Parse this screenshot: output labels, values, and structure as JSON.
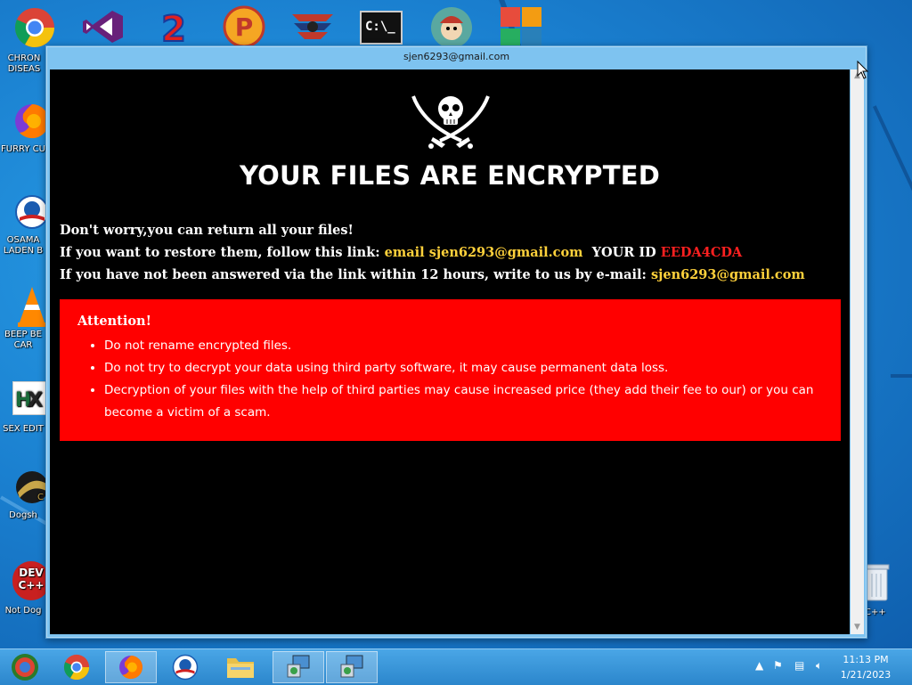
{
  "desktop": {
    "icons": [
      {
        "label": "CHRON DISEAS",
        "icon": "chrome-icon"
      },
      {
        "label": "FURRY CU",
        "icon": "firefox-icon"
      },
      {
        "label": "OSAMA LADEN B",
        "icon": "obama-logo-icon"
      },
      {
        "label": "BEEP BE CAR",
        "icon": "vlc-cone-icon"
      },
      {
        "label": "SEX EDIT",
        "icon": "hxd-editor-icon"
      },
      {
        "label": "Dogsh",
        "icon": "dogecoin-icon"
      },
      {
        "label": "Not Dog",
        "icon": "dev-cpp-icon"
      },
      {
        "label": "n C++",
        "icon": "recycle-bin-icon"
      }
    ],
    "top_icons": [
      "chrome-icon",
      "visual-studio-icon",
      "app-2-icon",
      "pacman-p-icon",
      "eagle-icon",
      "cmd-icon",
      "mascot-icon",
      "avg-icon"
    ],
    "dev_icon_text": "DEV C++",
    "cmd_icon_text": "C:\\_"
  },
  "window": {
    "title": "sjen6293@gmail.com",
    "headline": "YOUR FILES ARE ENCRYPTED",
    "line1": "Don't worry,you can return all your files!",
    "line2_prefix": "If you want to restore them, follow this link:",
    "line2_email": "email sjen6293@gmail.com",
    "line2_id_label": "YOUR ID",
    "line2_id_value": "EEDA4CDA",
    "line3_prefix": "If you have not been answered via the link within 12 hours, write to us by e-mail:",
    "line3_email": "sjen6293@gmail.com",
    "attention": {
      "title": "Attention!",
      "items": [
        "Do not rename encrypted files.",
        "Do not try to decrypt your data using third party software, it may cause permanent data loss.",
        "Decryption of your files with the help of third parties may cause increased price (they add their fee to our) or you can become a victim of a scam."
      ]
    }
  },
  "taskbar": {
    "buttons": [
      "start-button",
      "chrome-icon",
      "firefox-icon",
      "obama-logo-icon",
      "file-explorer-icon",
      "installer-icon",
      "installer-icon"
    ],
    "clock_time": "11:13 PM",
    "clock_date": "1/21/2023"
  },
  "colors": {
    "window_bg": "#000000",
    "attention_bg": "#ff0000",
    "email_yellow": "#ffd13b",
    "id_red": "#ff2020",
    "taskbar": "#2b86cc"
  }
}
